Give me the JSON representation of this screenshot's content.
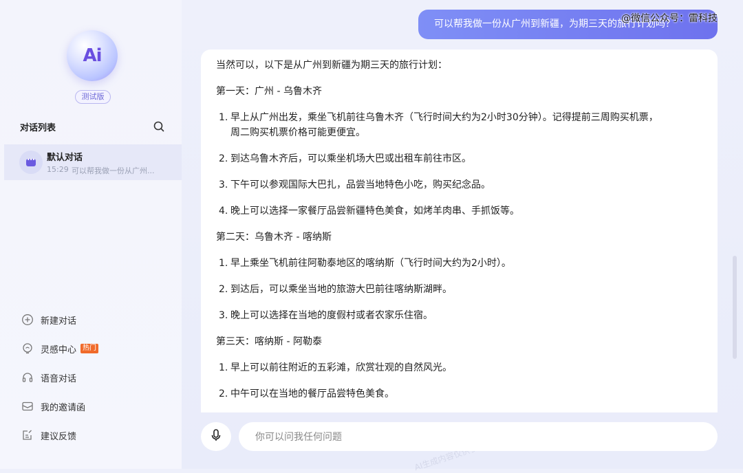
{
  "header": {
    "watermark_brand": "@微信公众号：雷科技"
  },
  "sidebar": {
    "logo_text": "Ai",
    "beta_badge": "测试版",
    "conversation_list_title": "对话列表",
    "conversations": [
      {
        "name": "默认对话",
        "time": "15:29",
        "preview": "可以帮我做一份从广州..."
      }
    ],
    "menu": [
      {
        "label": "新建对话",
        "icon": "plus-circle-icon"
      },
      {
        "label": "灵感中心",
        "icon": "lightbulb-icon",
        "badge": "热门"
      },
      {
        "label": "语音对话",
        "icon": "headphones-icon"
      },
      {
        "label": "我的邀请函",
        "icon": "envelope-icon"
      },
      {
        "label": "建议反馈",
        "icon": "feedback-icon"
      }
    ]
  },
  "chat": {
    "user_message": "可以帮我做一份从广州到新疆，为期三天的旅行计划吗？",
    "answer": {
      "intro": "当然可以，以下是从广州到新疆为期三天的旅行计划：",
      "days": [
        {
          "title": "第一天：广州 - 乌鲁木齐",
          "items": [
            "早上从广州出发，乘坐飞机前往乌鲁木齐（飞行时间大约为2小时30分钟）。记得提前三周购买机票，",
            "到达乌鲁木齐后，可以乘坐机场大巴或出租车前往市区。",
            "下午可以参观国际大巴扎，品尝当地特色小吃，购买纪念品。",
            "晚上可以选择一家餐厅品尝新疆特色美食，如烤羊肉串、手抓饭等。"
          ],
          "item1_continuation": "周二购买机票价格可能更便宜。"
        },
        {
          "title": "第二天：乌鲁木齐 - 喀纳斯",
          "items": [
            "早上乘坐飞机前往阿勒泰地区的喀纳斯（飞行时间大约为2小时）。",
            "到达后，可以乘坐当地的旅游大巴前往喀纳斯湖畔。",
            "晚上可以选择在当地的度假村或者农家乐住宿。"
          ]
        },
        {
          "title": "第三天：喀纳斯 - 阿勒泰",
          "items": [
            "早上可以前往附近的五彩滩，欣赏壮观的自然风光。",
            "中午可以在当地的餐厅品尝特色美食。"
          ]
        }
      ]
    },
    "input": {
      "placeholder": "你可以问我任何问题",
      "value": ""
    }
  },
  "watermark_text": "AI生成内容仅供参考",
  "colors": {
    "accent": "#6e72ee",
    "hot_badge": "#f06a2a",
    "sidebar_selected": "#e6e8f8"
  }
}
